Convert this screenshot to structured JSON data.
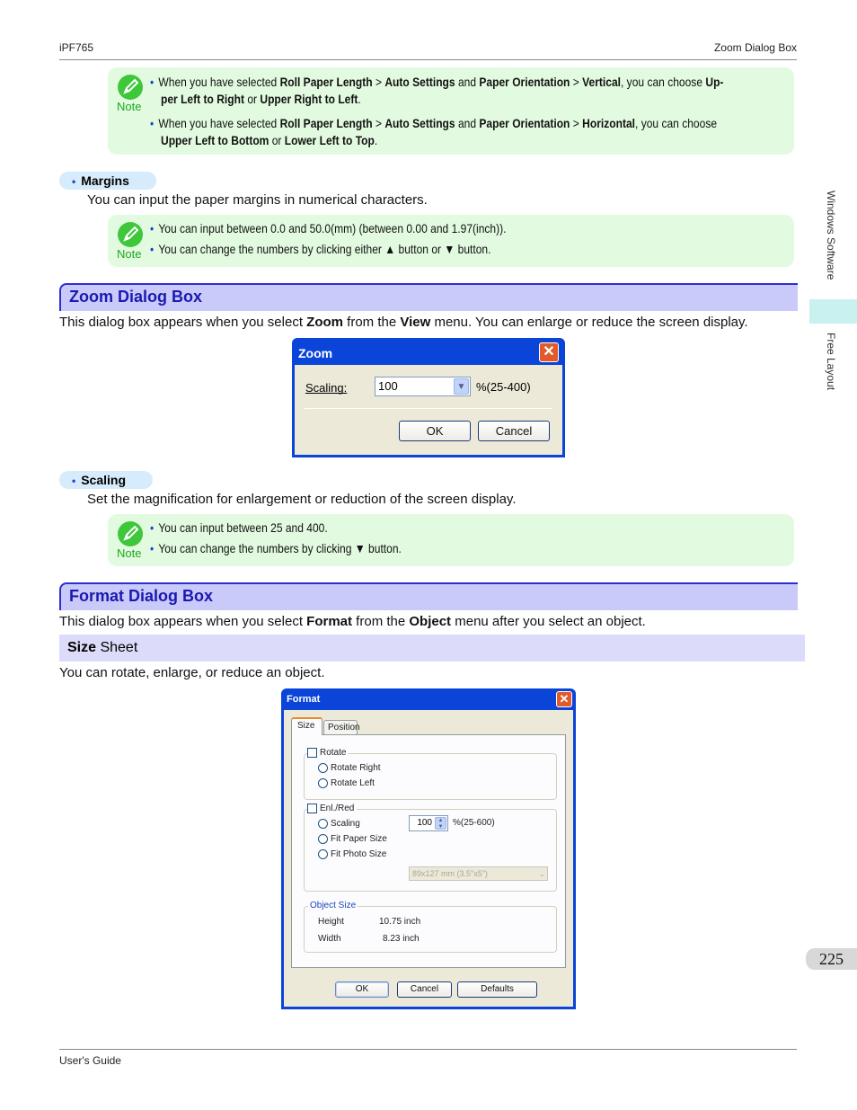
{
  "header": {
    "left": "iPF765",
    "right": "Zoom Dialog Box"
  },
  "footer": {
    "left": "User's Guide"
  },
  "side_tabs": {
    "upper": "Windows Software",
    "lower": "Free Layout"
  },
  "page_number": "225",
  "note_label": "Note",
  "note1": {
    "items": [
      {
        "parts": [
          "When you have selected ",
          "Roll Paper Length",
          " > ",
          "Auto Settings",
          " and ",
          "Paper Orientation",
          " > ",
          "Vertical",
          ", you can choose ",
          "Up-"
        ],
        "line2": [
          "per Left to Right",
          " or ",
          "Upper Right to Left",
          "."
        ]
      },
      {
        "parts": [
          "When you have selected ",
          "Roll Paper Length",
          " > ",
          "Auto Settings",
          " and ",
          "Paper Orientation",
          " > ",
          "Horizontal",
          ", you can choose"
        ],
        "line2": [
          "Upper Left to Bottom",
          " or ",
          "Lower Left to Top",
          "."
        ]
      }
    ]
  },
  "margins": {
    "heading": "Margins",
    "text": "You can input the paper margins in numerical characters.",
    "notes": [
      "You can input between 0.0 and 50.0(mm) (between 0.00 and 1.97(inch)).",
      "You can change the numbers by clicking either ▲ button or ▼ button."
    ]
  },
  "zoom_section": {
    "title": "Zoom Dialog Box",
    "intro": [
      "This dialog box appears when you select ",
      "Zoom",
      " from the ",
      "View",
      " menu. You can enlarge or reduce the screen display."
    ]
  },
  "zoom_dialog": {
    "title": "Zoom",
    "close": "✕",
    "scaling_label": "Scaling:",
    "scaling_value": "100",
    "range": "%(25-400)",
    "ok": "OK",
    "cancel": "Cancel"
  },
  "scaling": {
    "heading": "Scaling",
    "text": "Set the magnification for enlargement or reduction of the screen display.",
    "notes": [
      "You can input between 25 and 400.",
      "You can change the numbers by clicking ▼ button."
    ]
  },
  "format_section": {
    "title": "Format Dialog Box",
    "intro": [
      "This dialog box appears when you select ",
      "Format",
      " from the ",
      "Object",
      " menu after you select an object."
    ],
    "sub_bold": "Size",
    "sub_rest": " Sheet",
    "sub_text": "You can rotate, enlarge, or reduce an object."
  },
  "format_dialog": {
    "title": "Format",
    "close": "✕",
    "tabs": [
      "Size",
      "Position"
    ],
    "rotate": {
      "label": "Rotate",
      "options": [
        "Rotate Right",
        "Rotate Left"
      ]
    },
    "enlred": {
      "label": "Enl./Red",
      "options": [
        "Scaling",
        "Fit Paper Size",
        "Fit Photo Size"
      ],
      "scaling_value": "100",
      "range": "%(25-600)",
      "photo_size": "89x127 mm (3.5\"x5\")"
    },
    "object_size": {
      "label": "Object Size",
      "height_label": "Height",
      "height_value": "10.75 inch",
      "width_label": "Width",
      "width_value": "8.23 inch"
    },
    "buttons": {
      "ok": "OK",
      "cancel": "Cancel",
      "defaults": "Defaults"
    }
  }
}
